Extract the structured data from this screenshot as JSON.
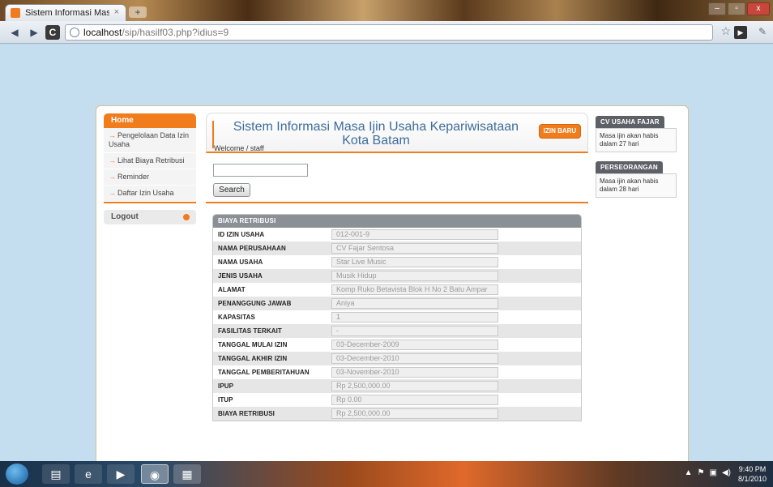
{
  "browser": {
    "tab_title": "Sistem Informasi Masa Iji...",
    "tab_close": "×",
    "new_tab": "+",
    "url_host": "localhost",
    "url_path": "/sip/hasilf03.php?idius=9",
    "window_controls": [
      "–",
      "▫",
      "x"
    ]
  },
  "menu": {
    "home": "Home",
    "items": [
      "Pengelolaan Data Izin Usaha",
      "Lihat Biaya Retribusi",
      "Reminder",
      "Daftar Izin Usaha"
    ],
    "logout": "Logout"
  },
  "header": {
    "title": "Sistem Informasi Masa Ijin Usaha Kepariwisataan Kota Batam",
    "welcome": "Welcome / staff",
    "izin_baru": "IZIN BARU"
  },
  "search": {
    "value": "",
    "button": "Search"
  },
  "table": {
    "title": "BIAYA RETRIBUSI",
    "rows": [
      {
        "label": "ID IZIN USAHA",
        "value": "012-001-9"
      },
      {
        "label": "NAMA PERUSAHAAN",
        "value": "CV Fajar Sentosa"
      },
      {
        "label": "NAMA USAHA",
        "value": "Star Live Music"
      },
      {
        "label": "JENIS USAHA",
        "value": "Musik Hidup"
      },
      {
        "label": "ALAMAT",
        "value": "Komp Ruko Betavista Blok H No 2 Batu Ampar"
      },
      {
        "label": "PENANGGUNG JAWAB",
        "value": "Aniya"
      },
      {
        "label": "KAPASITAS",
        "value": "1"
      },
      {
        "label": "FASILITAS TERKAIT",
        "value": "-"
      },
      {
        "label": "TANGGAL MULAI IZIN",
        "value": "03-December-2009"
      },
      {
        "label": "TANGGAL AKHIR IZIN",
        "value": "03-December-2010"
      },
      {
        "label": "TANGGAL PEMBERITAHUAN",
        "value": "03-November-2010"
      },
      {
        "label": "IPUP",
        "value": "Rp 2,500,000.00"
      },
      {
        "label": "ITUP",
        "value": "Rp 0.00"
      },
      {
        "label": "BIAYA RETRIBUSI",
        "value": "Rp 2,500,000.00"
      }
    ]
  },
  "notices": [
    {
      "title": "CV USAHA FAJAR",
      "text": "Masa ijin akan habis dalam 27 hari"
    },
    {
      "title": "PERSEORANGAN",
      "text": "Masa ijin akan habis dalam 28 hari"
    }
  ],
  "taskbar": {
    "time": "9:40 PM",
    "date": "8/1/2010"
  },
  "colors": {
    "accent": "#f07c1c",
    "title_blue": "#3d6c9c",
    "page_bg": "#c4deef"
  }
}
